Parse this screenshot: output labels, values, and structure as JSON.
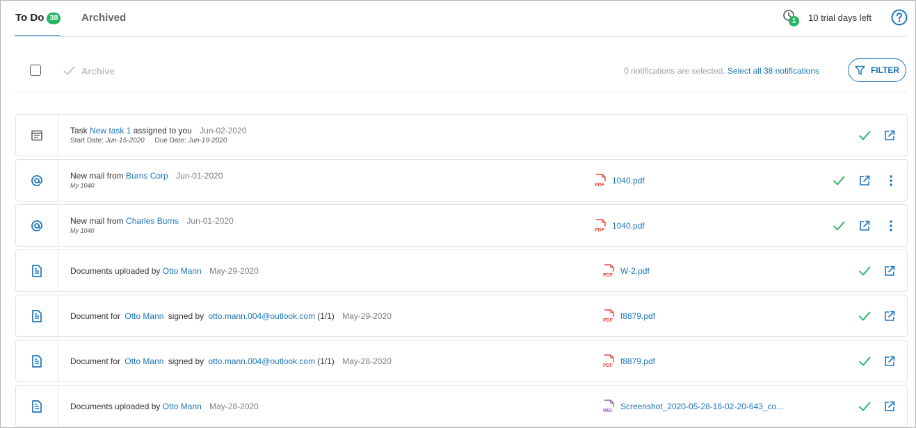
{
  "tabs": {
    "todo_label": "To Do",
    "todo_count": "38",
    "archived_label": "Archived"
  },
  "trial": {
    "count": "1",
    "text": "10 trial days left"
  },
  "toolbar": {
    "archive_label": "Archive",
    "selection_text": "0 notifications are selected.",
    "select_all_link": "Select all 38 notifications",
    "filter_label": "FILTER"
  },
  "colors": {
    "accent": "#1b75bc",
    "success": "#21b661",
    "pdf": "#e8473c",
    "img": "#9b59b6"
  },
  "notifications": [
    {
      "icon": "calendar-task-icon",
      "prefix": "Task",
      "link": "New task 1",
      "suffix": "assigned to you",
      "date": "Jun-02-2020",
      "start_label": "Start Date:",
      "start_value": "Jun-15-2020",
      "due_label": "Due Date:",
      "due_value": "Jun-19-2020"
    },
    {
      "icon": "at-mail-icon",
      "prefix": "New mail from",
      "link": "Burns Corp",
      "date": "Jun-01-2020",
      "sub": "My 1040",
      "file": "1040.pdf",
      "file_type": "PDF"
    },
    {
      "icon": "at-mail-icon",
      "prefix": "New mail from",
      "link": "Charles Burns",
      "date": "Jun-01-2020",
      "sub": "My 1040",
      "file": "1040.pdf",
      "file_type": "PDF"
    },
    {
      "icon": "document-icon",
      "prefix": "Documents uploaded by",
      "link": "Otto Mann",
      "date": "May-29-2020",
      "file": "W-2.pdf",
      "file_type": "PDF"
    },
    {
      "icon": "document-icon",
      "prefix": "Document for",
      "link": "Otto Mann",
      "middle": "signed by",
      "link2": "otto.mann.004@outlook.com",
      "count": "(1/1)",
      "date": "May-29-2020",
      "file": "f8879.pdf",
      "file_type": "PDF"
    },
    {
      "icon": "document-icon",
      "prefix": "Document for",
      "link": "Otto Mann",
      "middle": "signed by",
      "link2": "otto.mann.004@outlook.com",
      "count": "(1/1)",
      "date": "May-28-2020",
      "file": "f8879.pdf",
      "file_type": "PDF"
    },
    {
      "icon": "document-icon",
      "prefix": "Documents uploaded by",
      "link": "Otto Mann",
      "date": "May-28-2020",
      "file": "Screenshot_2020-05-28-16-02-20-643_co...",
      "file_type": "IMG"
    }
  ]
}
